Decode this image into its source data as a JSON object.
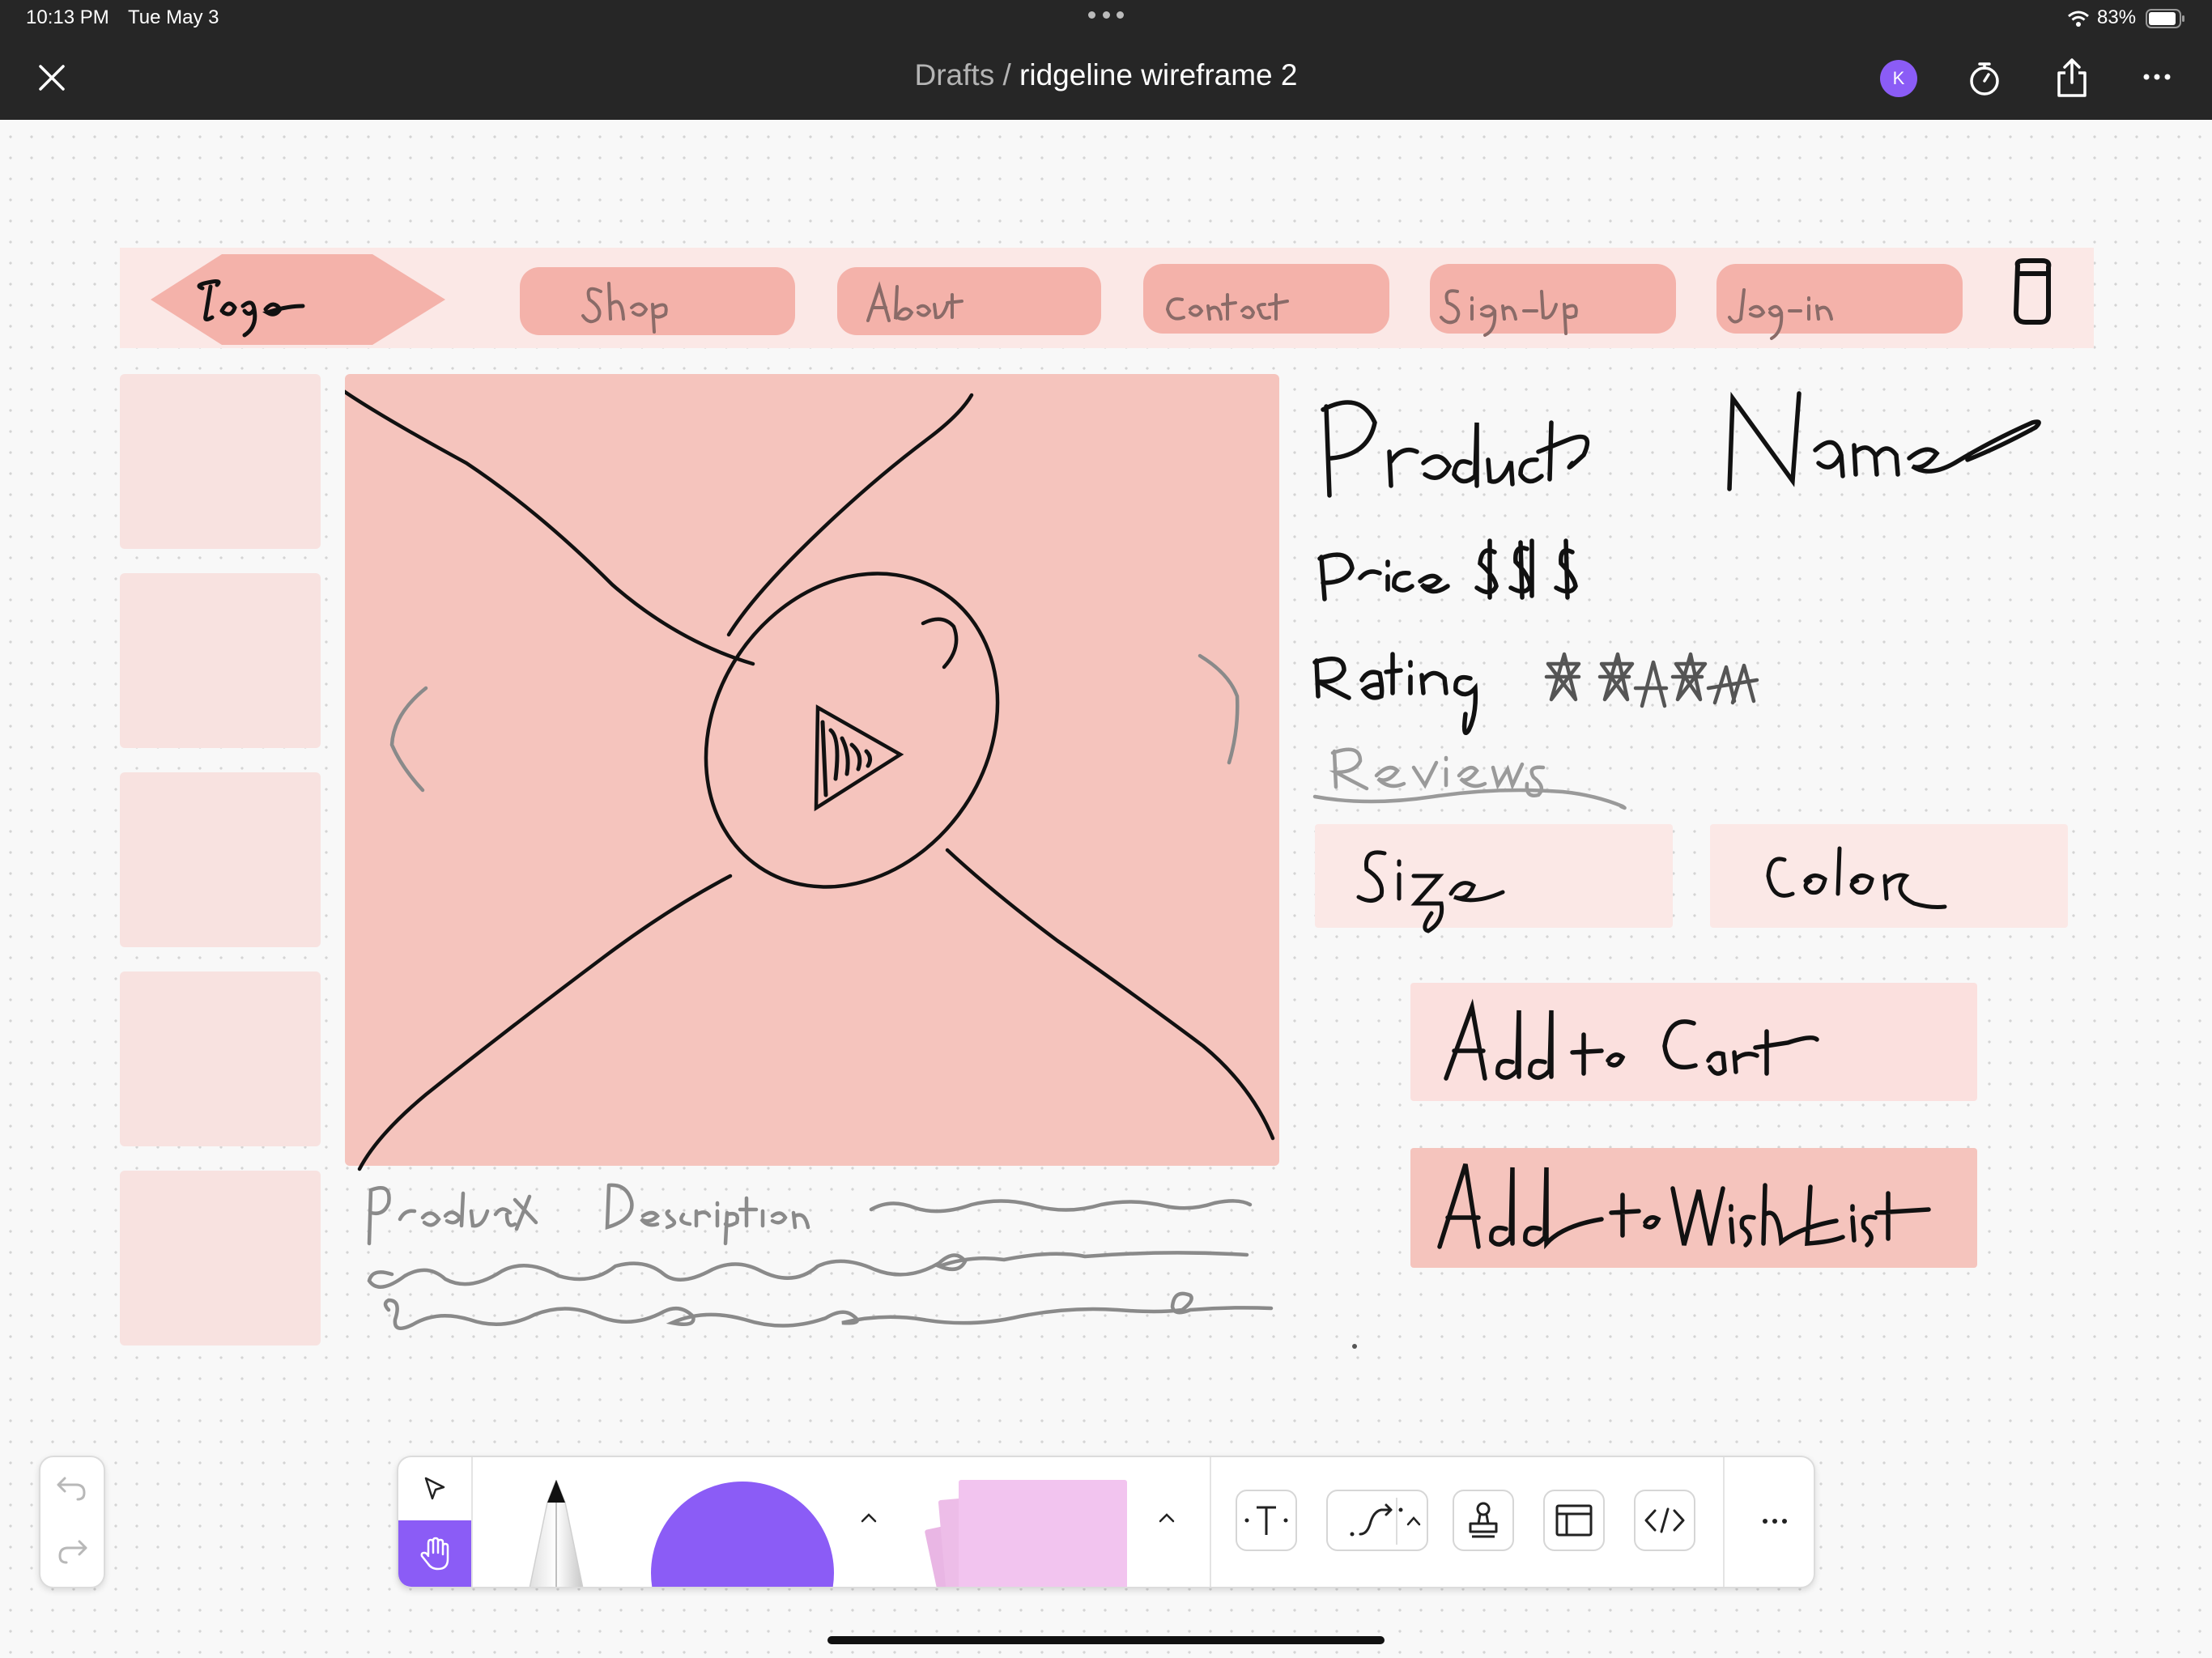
{
  "status_bar": {
    "time": "10:13 PM",
    "date": "Tue May 3",
    "battery": "83%"
  },
  "header": {
    "breadcrumb_parent": "Drafts",
    "separator": " / ",
    "file_name": "ridgeline wireframe 2",
    "avatar_initial": "K"
  },
  "colors": {
    "title_bar": "#262626",
    "nav_strip": "#fbe8e6",
    "nav_pill": "#f4b2aa",
    "product_image": "#f5c4bd",
    "thumbnail": "#f8e2e0",
    "accent_purple": "#8b5cf6",
    "sticky_note": "#f2c4ef"
  },
  "sketch": {
    "logo": "Logo",
    "nav": [
      "Shop",
      "About",
      "Contact",
      "Sign-up",
      "Log-in"
    ],
    "product_name": "Product Name",
    "price": "Price $$$",
    "rating": "Rating",
    "reviews": "Reviews",
    "size": "Size",
    "color": "Color",
    "add_to_cart": "Add to Cart",
    "add_to_wishlist": "Add to Wish List",
    "product_description": "Product Description"
  },
  "toolbar": {
    "icons": [
      "close-icon",
      "timer-icon",
      "share-icon",
      "more-icon",
      "select-icon",
      "hand-icon",
      "pen-icon",
      "shape-icon",
      "sticky-note-icon",
      "text-icon",
      "connector-icon",
      "stamp-icon",
      "section-icon",
      "code-icon",
      "undo-icon",
      "redo-icon"
    ]
  }
}
